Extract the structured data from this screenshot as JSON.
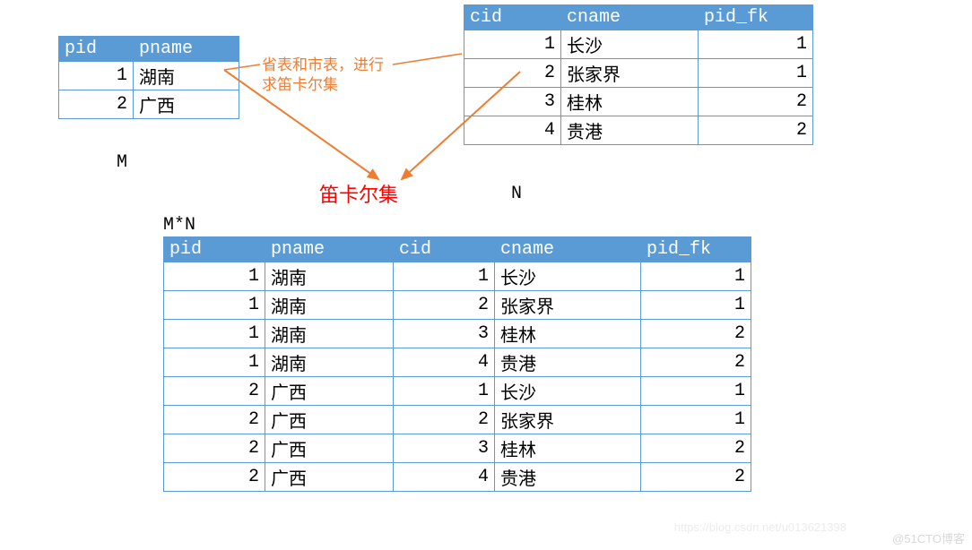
{
  "province_table": {
    "headers": [
      "pid",
      "pname"
    ],
    "rows": [
      {
        "pid": 1,
        "pname": "湖南"
      },
      {
        "pid": 2,
        "pname": "广西"
      }
    ]
  },
  "city_table": {
    "headers": [
      "cid",
      "cname",
      "pid_fk"
    ],
    "rows": [
      {
        "cid": 1,
        "cname": "长沙",
        "pid_fk": 1
      },
      {
        "cid": 2,
        "cname": "张家界",
        "pid_fk": 1
      },
      {
        "cid": 3,
        "cname": "桂林",
        "pid_fk": 2
      },
      {
        "cid": 4,
        "cname": "贵港",
        "pid_fk": 2
      }
    ]
  },
  "result_table": {
    "headers": [
      "pid",
      "pname",
      "cid",
      "cname",
      "pid_fk"
    ],
    "rows": [
      {
        "pid": 1,
        "pname": "湖南",
        "cid": 1,
        "cname": "长沙",
        "pid_fk": 1
      },
      {
        "pid": 1,
        "pname": "湖南",
        "cid": 2,
        "cname": "张家界",
        "pid_fk": 1
      },
      {
        "pid": 1,
        "pname": "湖南",
        "cid": 3,
        "cname": "桂林",
        "pid_fk": 2
      },
      {
        "pid": 1,
        "pname": "湖南",
        "cid": 4,
        "cname": "贵港",
        "pid_fk": 2
      },
      {
        "pid": 2,
        "pname": "广西",
        "cid": 1,
        "cname": "长沙",
        "pid_fk": 1
      },
      {
        "pid": 2,
        "pname": "广西",
        "cid": 2,
        "cname": "张家界",
        "pid_fk": 1
      },
      {
        "pid": 2,
        "pname": "广西",
        "cid": 3,
        "cname": "桂林",
        "pid_fk": 2
      },
      {
        "pid": 2,
        "pname": "广西",
        "cid": 4,
        "cname": "贵港",
        "pid_fk": 2
      }
    ]
  },
  "annotation": {
    "line1": "省表和市表，进行",
    "line2": "求笛卡尔集"
  },
  "labels": {
    "M": "M",
    "N": "N",
    "MN": "M*N",
    "cartesian": "笛卡尔集"
  },
  "watermark": "@51CTO博客",
  "watermark2": "https://blog.csdn.net/u013621398",
  "colors": {
    "header_bg": "#5b9bd5",
    "arrow": "#ed7d31",
    "title": "#ff0000"
  }
}
